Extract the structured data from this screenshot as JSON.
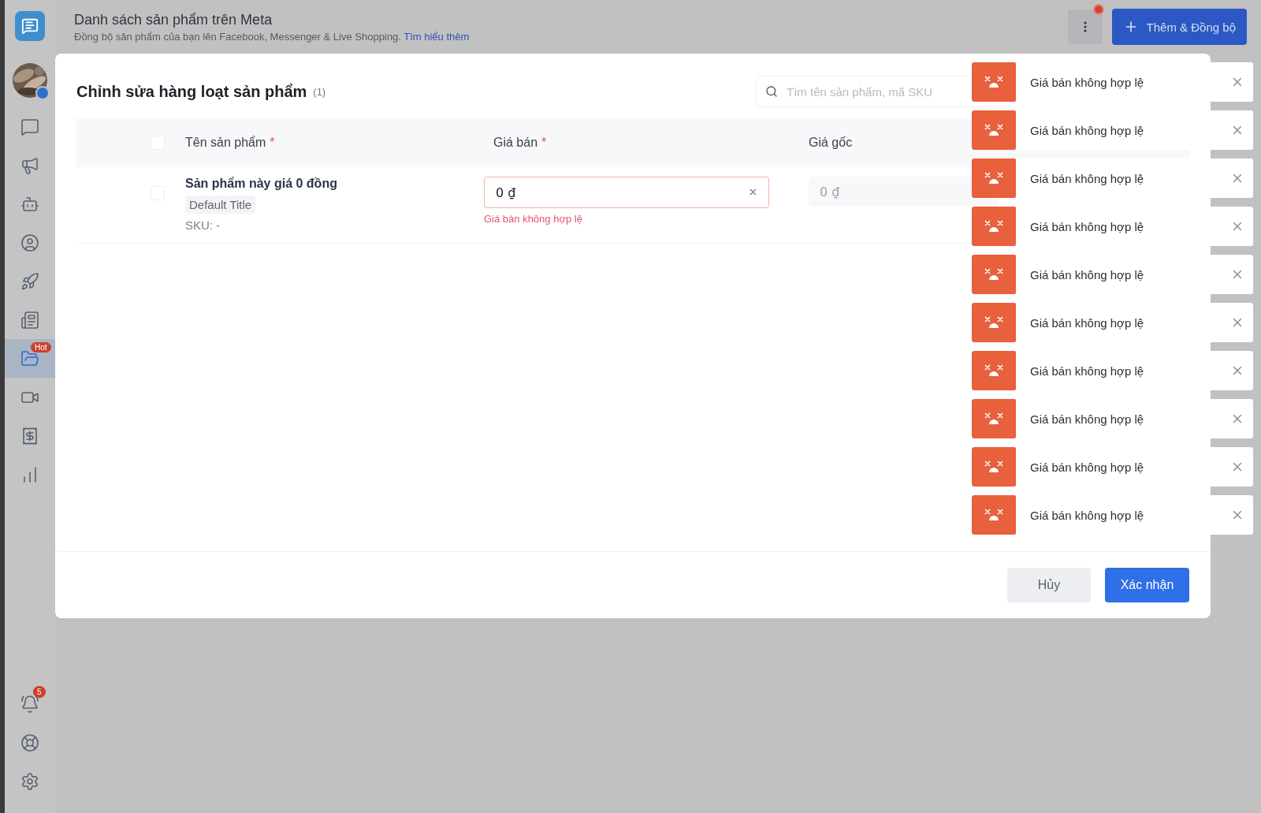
{
  "header": {
    "title": "Danh sách sản phẩm trên Meta",
    "subtitle": "Đồng bộ sản phẩm của bạn lên Facebook, Messenger & Live Shopping.",
    "link": "Tìm hiểu thêm",
    "more_has_dot": true,
    "add_button": "Thêm & Đồng bộ"
  },
  "sidebar": {
    "top": [
      {
        "kind": "chat",
        "selected": false
      },
      {
        "kind": "megaphone",
        "selected": false
      },
      {
        "kind": "bot",
        "selected": false
      },
      {
        "kind": "user",
        "selected": false
      },
      {
        "kind": "rocket",
        "selected": false
      },
      {
        "kind": "newspaper",
        "selected": false
      },
      {
        "kind": "catalog",
        "selected": true,
        "badge": "Hot"
      },
      {
        "kind": "video",
        "selected": false
      },
      {
        "kind": "receipt",
        "selected": false
      },
      {
        "kind": "chart",
        "selected": false
      }
    ],
    "bottom": [
      {
        "kind": "bell",
        "selected": false,
        "badge": "5"
      },
      {
        "kind": "help",
        "selected": false
      },
      {
        "kind": "settings",
        "selected": false
      }
    ]
  },
  "modal": {
    "title": "Chỉnh sửa hàng loạt sản phẩm",
    "count": "(1)",
    "search": {
      "placeholder": "Tìm tên sản phẩm, mã SKU"
    },
    "header_checked": false,
    "columns": [
      {
        "label": "Tên sản phẩm",
        "required_mark": "*"
      },
      {
        "label": "Giá bán",
        "required_mark": "*"
      },
      {
        "label": "Giá gốc"
      }
    ],
    "rows": [
      {
        "checked": false,
        "name": "Sản phẩm này giá 0 đồng",
        "variant": "Default Title",
        "sku": "SKU: -",
        "price": "0 ₫",
        "price_error": "Giá bán không hợp lệ",
        "original_price": {
          "placeholder": "0 ₫"
        }
      }
    ],
    "buttons": {
      "cancel": "Hủy",
      "confirm": "Xác nhận"
    }
  },
  "toasts": [
    {
      "message": "Giá bán không hợp lệ"
    },
    {
      "message": "Giá bán không hợp lệ"
    },
    {
      "message": "Giá bán không hợp lệ"
    },
    {
      "message": "Giá bán không hợp lệ"
    },
    {
      "message": "Giá bán không hợp lệ"
    },
    {
      "message": "Giá bán không hợp lệ"
    },
    {
      "message": "Giá bán không hợp lệ"
    },
    {
      "message": "Giá bán không hợp lệ"
    },
    {
      "message": "Giá bán không hợp lệ"
    },
    {
      "message": "Giá bán không hợp lệ"
    }
  ]
}
